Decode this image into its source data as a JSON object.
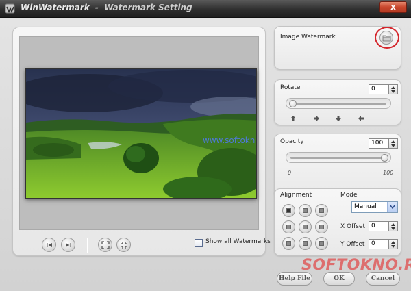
{
  "window": {
    "app_name": "WinWatermark",
    "separator": "-",
    "subtitle": "Watermark Setting",
    "close_label": "x"
  },
  "preview": {
    "watermark_text": "www.softokno.ru",
    "show_all_label": "Show all Watermarks",
    "show_all_checked": false
  },
  "image_watermark": {
    "label": "Image Watermark"
  },
  "rotate": {
    "label": "Rotate",
    "value": "0"
  },
  "opacity": {
    "label": "Opacity",
    "value": "100",
    "min_label": "0",
    "max_label": "100"
  },
  "alignment": {
    "label": "Alignment",
    "selected": "top-left"
  },
  "mode": {
    "label": "Mode",
    "value": "Manual",
    "x_offset_label": "X Offset",
    "x_offset_value": "0",
    "y_offset_label": "Y Offset",
    "y_offset_value": "0"
  },
  "buttons": {
    "help_label": "Help File",
    "ok_label": "OK",
    "cancel_label": "Cancel"
  },
  "overlay_logo": {
    "text": "SOFTOKNO.RU"
  },
  "colors": {
    "title_bar": "#2f2f2f",
    "close_button": "#c8462c",
    "watermark_text": "#4e79d8",
    "highlight_ring": "#d4262c"
  }
}
